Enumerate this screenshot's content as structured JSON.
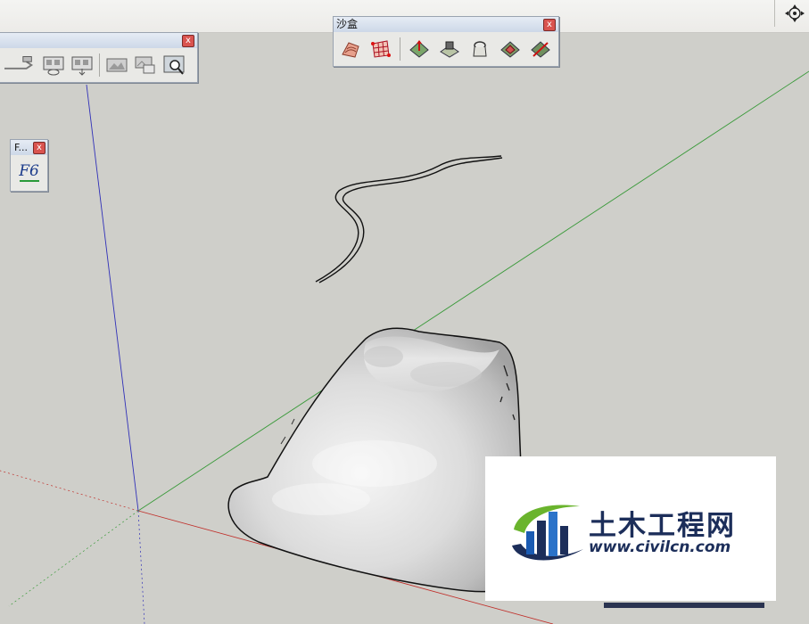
{
  "sandbox_toolbar": {
    "title": "沙盒",
    "close": "x",
    "tools": [
      {
        "icon": "from-contours-icon"
      },
      {
        "icon": "from-scratch-icon"
      },
      {
        "icon": "smoove-icon"
      },
      {
        "icon": "stamp-icon"
      },
      {
        "icon": "drape-icon"
      },
      {
        "icon": "add-detail-icon"
      },
      {
        "icon": "flip-edge-icon"
      }
    ]
  },
  "views_toolbar": {
    "close": "x",
    "tools": [
      {
        "icon": "previous-view-icon"
      },
      {
        "icon": "section-view-icon"
      },
      {
        "icon": "export-view-icon"
      },
      {
        "icon": "scene-icon"
      },
      {
        "icon": "scene-add-icon"
      },
      {
        "icon": "zoom-window-icon"
      }
    ]
  },
  "f_palette": {
    "title": "F...",
    "close": "x",
    "button_label": "F6"
  },
  "watermark": {
    "brand_cn": "土木工程网",
    "url": "www.civilcn.com"
  },
  "colors": {
    "viewport_bg": "#cfcfca",
    "axis_red": "#c0302b",
    "axis_green": "#3a9a3a",
    "axis_blue": "#3030b8",
    "terrain_light": "#f2f2f2",
    "terrain_dark": "#9a9a9a",
    "brand_navy": "#1c2e5a",
    "brand_green": "#6ab42d"
  }
}
